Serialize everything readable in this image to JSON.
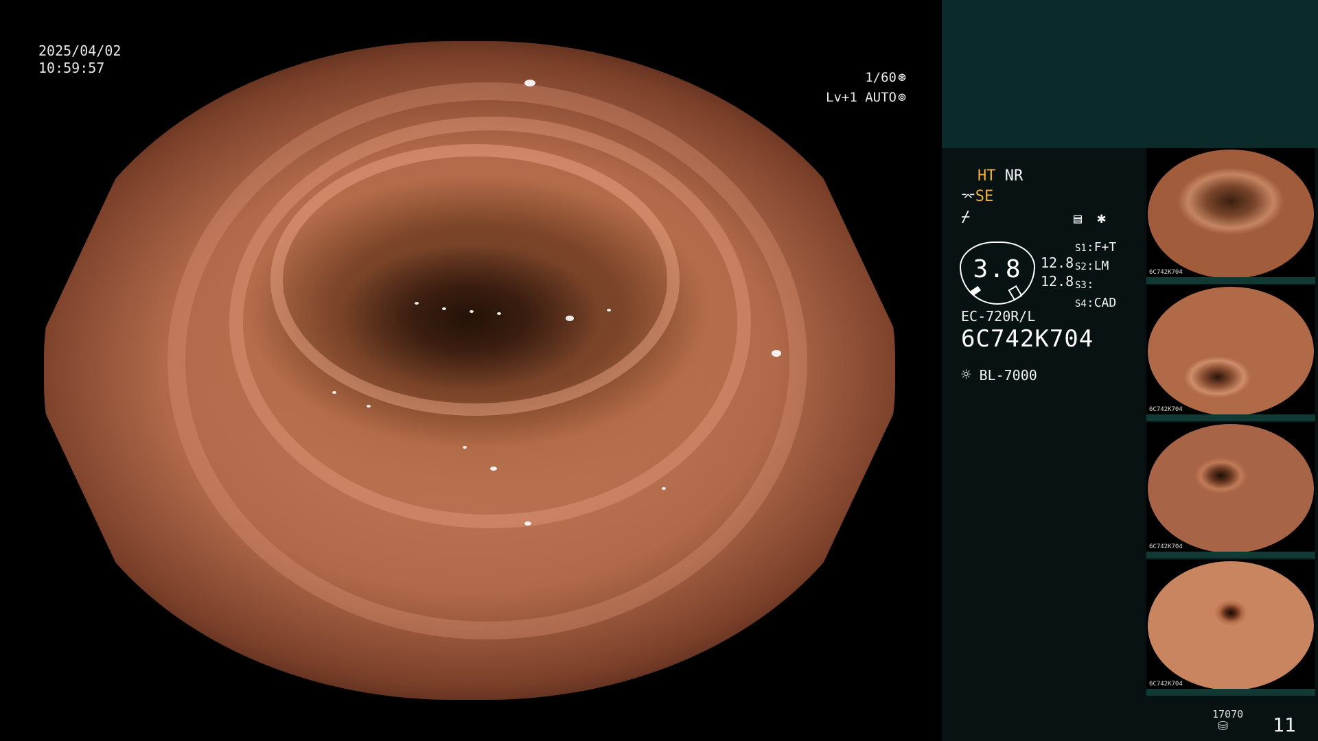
{
  "overlay": {
    "date": "2025/04/02",
    "time": "10:59:57",
    "shutter_speed": "1/60",
    "iris_level": "Lv+1 AUTO"
  },
  "settings": {
    "ht": "HT",
    "nr": "NR",
    "se": "SE",
    "magnification": "3.8",
    "value_a": "12.8",
    "value_b": "12.8",
    "s1_key": "S1",
    "s1_value": "F+T",
    "s2_key": "S2",
    "s2_value": "LM",
    "s3_key": "S3",
    "s3_value": "",
    "s4_key": "S4",
    "s4_value": "CAD",
    "scope_model": "EC-720R/L",
    "scope_serial": "6C742K704",
    "light_source": "BL-7000"
  },
  "captures": {
    "thumbnails": [
      {
        "caption": "6C742K704"
      },
      {
        "caption": "6C742K704"
      },
      {
        "caption": "6C742K704"
      },
      {
        "caption": "6C742K704"
      }
    ],
    "remaining": "17070",
    "count": "11"
  },
  "icons": [
    "shutter-icon",
    "iris-icon",
    "se-icon",
    "fn-icon",
    "menu-icon",
    "star-icon",
    "light-icon",
    "storage-icon"
  ],
  "colors": {
    "panel_bg": "#081212",
    "panel_top": "#0b2a2a",
    "amber": "#f1b13b"
  }
}
